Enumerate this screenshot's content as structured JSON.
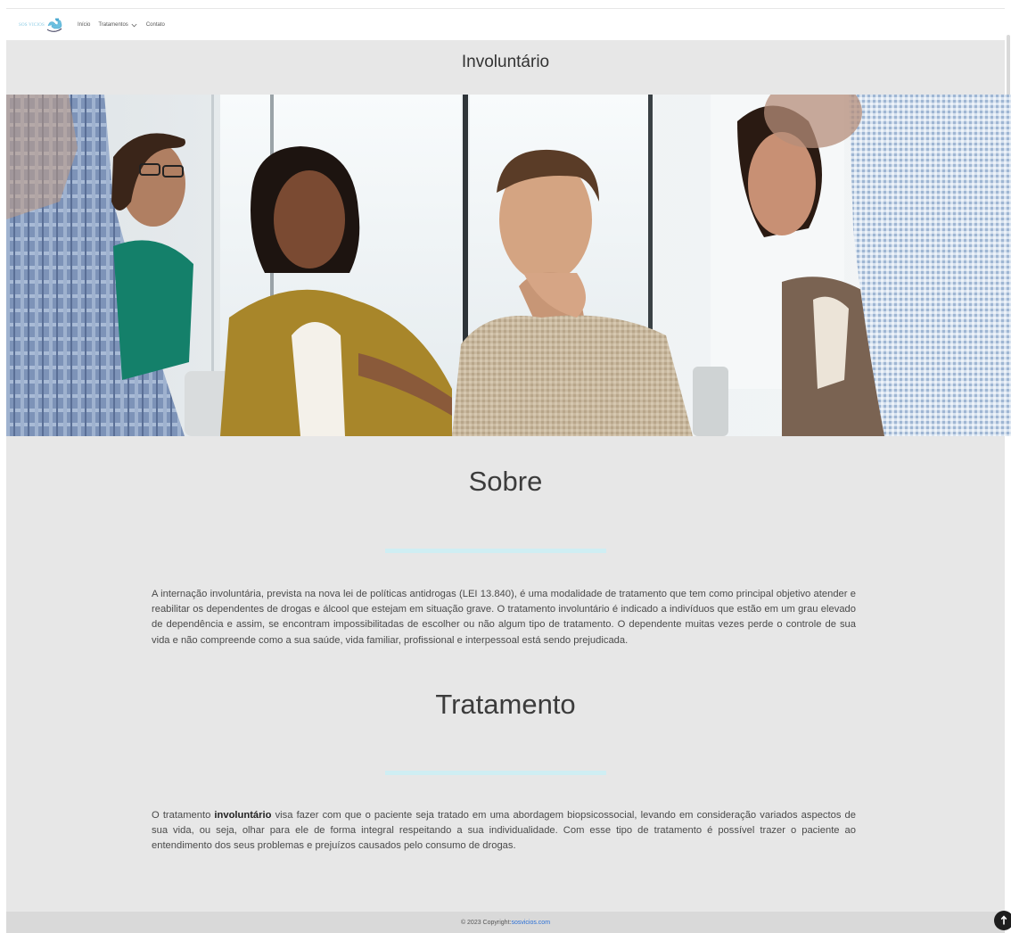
{
  "navbar": {
    "brand_text": "SOS VICIOS",
    "links": {
      "home": "Início",
      "treatments": "Tratamentos",
      "contact": "Contato"
    }
  },
  "page": {
    "title": "Involuntário"
  },
  "sections": {
    "about": {
      "heading": "Sobre",
      "text": "A internação involuntária, prevista na nova lei de políticas antidrogas (LEI 13.840), é uma modalidade de tratamento que tem como principal objetivo atender e reabilitar os dependentes de drogas e álcool que estejam em situação grave. O tratamento involuntário é indicado a indivíduos que estão em um grau elevado de dependência e assim, se encontram impossibilitadas de escolher ou não algum tipo de tratamento. O dependente muitas vezes perde o controle de sua vida e não compreende como a sua saúde, vida familiar, profissional e interpessoal está sendo prejudicada."
    },
    "treatment": {
      "heading": "Tratamento",
      "text_before": "O tratamento ",
      "text_bold": "involuntário",
      "text_after": " visa fazer com que o paciente seja tratado em uma abordagem biopsicossocial, levando em consideração variados aspectos de sua vida, ou seja, olhar para ele de forma integral respeitando a sua individualidade. Com esse tipo de tratamento é possível trazer o paciente ao entendimento dos seus problemas e prejuízos causados pelo consumo de drogas."
    }
  },
  "footer": {
    "copyright": "© 2023 Copyright: ",
    "link_text": "sosvicios.com"
  },
  "colors": {
    "accent_divider": "#cfeef3",
    "footer_link": "#2a6fd6",
    "brand": "#86c9e3"
  },
  "icons": {
    "logo": "hand-heart-logo",
    "dropdown": "chevron-down-icon",
    "back_to_top": "arrow-up-icon"
  }
}
